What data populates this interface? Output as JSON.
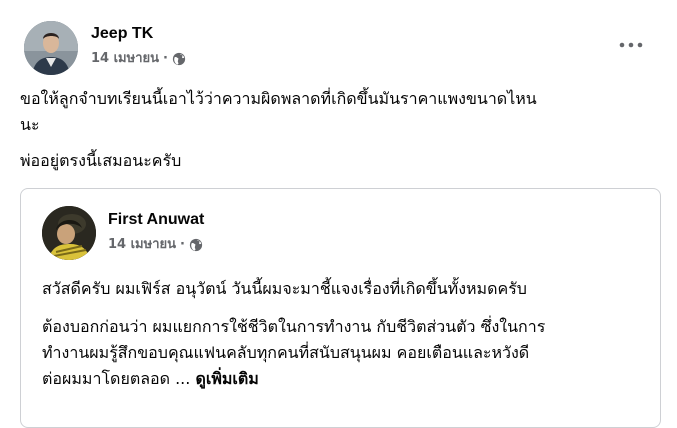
{
  "post": {
    "author_name": "Jeep TK",
    "date": "14 เมษายน",
    "separator": "·",
    "privacy_icon": "globe-icon",
    "more_icon": "more-options-icon",
    "text_line_1": "ขอให้ลูกจำบทเรียนนี้เอาไว้ว่าความผิดพลาดที่เกิดขึ้นมันราคาแพงขนาดไหน",
    "text_line_2": "นะ",
    "text_line_3": "พ่ออยู่ตรงนี้เสมอนะครับ"
  },
  "shared_post": {
    "author_name": "First Anuwat",
    "date": "14 เมษายน",
    "separator": "·",
    "privacy_icon": "globe-icon",
    "paragraph_1": "สวัสดีครับ ผมเฟิร์ส อนุวัตน์ วันนี้ผมจะมาชี้แจงเรื่องที่เกิดขึ้นทั้งหมดครับ",
    "paragraph_2_line_1": "ต้องบอกก่อนว่า ผมแยกการใช้ชีวิตในการทำงาน กับชีวิตส่วนตัว ซึ่งในการ",
    "paragraph_2_line_2": "ทำงานผมรู้สึกขอบคุณแฟนคลับทุกคนที่สนับสนุนผม คอยเตือนและหวังดี",
    "paragraph_2_line_3": "ต่อผมมาโดยตลอด ...",
    "see_more": "ดูเพิ่มเติม"
  }
}
